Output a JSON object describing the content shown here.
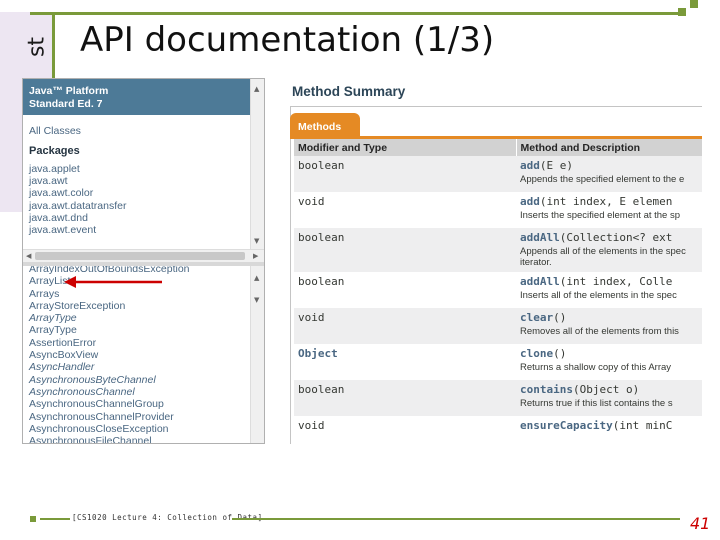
{
  "slide": {
    "side_label": "st",
    "title": "API documentation (1/3)",
    "footer": "[CS1020 Lecture 4: Collection of Data]",
    "page_number": "41"
  },
  "javadoc": {
    "header": "Java™ Platform\nStandard Ed. 7",
    "all_classes": "All Classes",
    "packages_title": "Packages",
    "packages": [
      "java.applet",
      "java.awt",
      "java.awt.color",
      "java.awt.datatransfer",
      "java.awt.dnd",
      "java.awt.event"
    ],
    "classes": [
      {
        "name": "ArrayIndexOutOfBoundsException",
        "italic": false
      },
      {
        "name": "ArrayList",
        "italic": false
      },
      {
        "name": "Arrays",
        "italic": false
      },
      {
        "name": "ArrayStoreException",
        "italic": false
      },
      {
        "name": "ArrayType",
        "italic": true
      },
      {
        "name": "ArrayType",
        "italic": false
      },
      {
        "name": "AssertionError",
        "italic": false
      },
      {
        "name": "AsyncBoxView",
        "italic": false
      },
      {
        "name": "AsyncHandler",
        "italic": true
      },
      {
        "name": "AsynchronousByteChannel",
        "italic": true
      },
      {
        "name": "AsynchronousChannel",
        "italic": true
      },
      {
        "name": "AsynchronousChannelGroup",
        "italic": false
      },
      {
        "name": "AsynchronousChannelProvider",
        "italic": false
      },
      {
        "name": "AsynchronousCloseException",
        "italic": false
      },
      {
        "name": "AsynchronousFileChannel",
        "italic": false
      }
    ]
  },
  "summary": {
    "title": "Method Summary",
    "tab": "Methods",
    "col_modifier": "Modifier and Type",
    "col_method": "Method and Description",
    "rows": [
      {
        "modifier": "boolean",
        "mod_link": false,
        "name": "add",
        "params": "(E e)",
        "desc": "Appends the specified element to the e",
        "desc2": ""
      },
      {
        "modifier": "void",
        "mod_link": false,
        "name": "add",
        "params": "(int index, E elemen",
        "desc": "Inserts the specified element at the sp",
        "desc2": ""
      },
      {
        "modifier": "boolean",
        "mod_link": false,
        "name": "addAll",
        "params": "(Collection<? ext",
        "desc": "Appends all of the elements in the spec",
        "desc2": "iterator."
      },
      {
        "modifier": "boolean",
        "mod_link": false,
        "name": "addAll",
        "params": "(int index, Colle",
        "desc": "Inserts all of the elements in the spec",
        "desc2": ""
      },
      {
        "modifier": "void",
        "mod_link": false,
        "name": "clear",
        "params": "()",
        "desc": "Removes all of the elements from this",
        "desc2": ""
      },
      {
        "modifier": "Object",
        "mod_link": true,
        "name": "clone",
        "params": "()",
        "desc": "Returns a shallow copy of this Array",
        "desc2": ""
      },
      {
        "modifier": "boolean",
        "mod_link": false,
        "name": "contains",
        "params": "(Object o)",
        "desc": "Returns true if this list contains the s",
        "desc2": ""
      },
      {
        "modifier": "void",
        "mod_link": false,
        "name": "ensureCapacity",
        "params": "(int minC",
        "desc": "",
        "desc2": ""
      }
    ]
  },
  "colors": {
    "accent": "#7a9a3a",
    "javadoc_header": "#4d7a97",
    "tab": "#e58a24",
    "arrow": "#cc0000"
  }
}
